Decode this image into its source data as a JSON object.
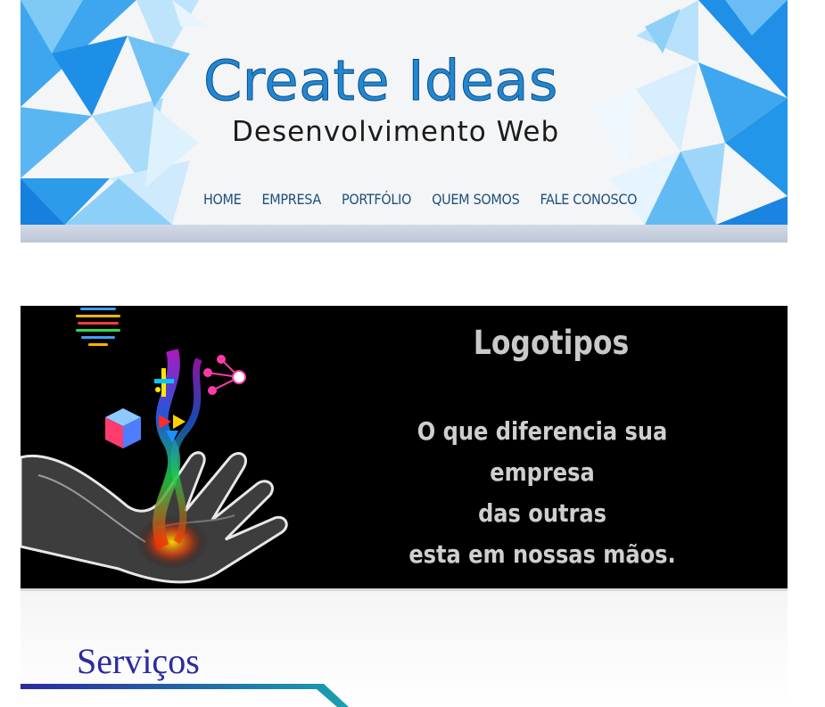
{
  "header": {
    "brand": "Create Ideas",
    "tagline": "Desenvolvimento Web",
    "nav": [
      "HOME",
      "EMPRESA",
      "PORTFÓLIO",
      "QUEM SOMOS",
      "FALE CONOSCO"
    ]
  },
  "banner": {
    "title": "Logotipos",
    "lines": [
      "O que diferencia sua  empresa",
      "das outras",
      "esta em nossas mãos."
    ]
  },
  "services": {
    "title": "Serviços"
  },
  "colors": {
    "brand_blue": "#2287d0",
    "nav_text": "#1c4e7b",
    "services_title": "#2b2aa0",
    "banner_bg": "#000000"
  }
}
